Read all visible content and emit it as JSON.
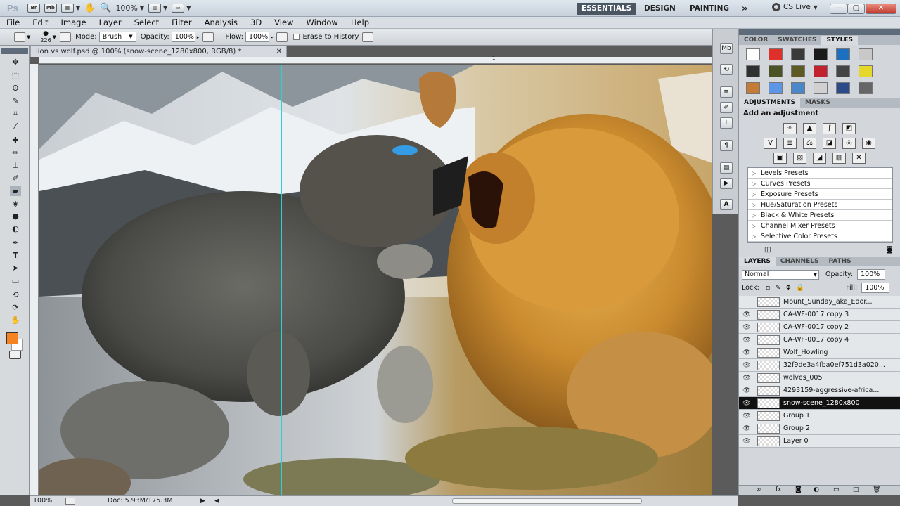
{
  "titlebar": {
    "logo": "Ps",
    "br": "Br",
    "mb": "Mb",
    "zoom": "100%",
    "workspaces": [
      "ESSENTIALS",
      "DESIGN",
      "PAINTING"
    ],
    "more": "»",
    "cs_live": "CS Live",
    "minimize": "—",
    "maximize": "▢",
    "close": "✕"
  },
  "menubar": {
    "items": [
      "File",
      "Edit",
      "Image",
      "Layer",
      "Select",
      "Filter",
      "Analysis",
      "3D",
      "View",
      "Window",
      "Help"
    ]
  },
  "options": {
    "brush_size": "226",
    "mode_label": "Mode:",
    "mode_value": "Brush",
    "opacity_label": "Opacity:",
    "opacity_value": "100%",
    "flow_label": "Flow:",
    "flow_value": "100%",
    "erase_history": "Erase to History"
  },
  "document": {
    "tab_title": "lion vs wolf.psd @ 100% (snow-scene_1280x800, RGB/8) *",
    "zoom": "100%",
    "doc_info": "Doc: 5.93M/175.3M",
    "ruler_mark": "1"
  },
  "panels": {
    "top_tabs": [
      "COLOR",
      "SWATCHES",
      "STYLES"
    ],
    "style_colors": [
      "#ffffff",
      "#e0302a",
      "#3a3a3a",
      "#1a1a1a",
      "#1d6fc0",
      "#c8c8c8",
      "#303030",
      "#4a5226",
      "#5d5a24",
      "#c2222d",
      "#444",
      "#e6d82a",
      "#c57a35",
      "#5f95e6",
      "#4a86c8",
      "#d0d0d0",
      "#2a4a8a",
      "#666"
    ],
    "adj_tabs": [
      "ADJUSTMENTS",
      "MASKS"
    ],
    "adj_title": "Add an adjustment",
    "presets": [
      "Levels Presets",
      "Curves Presets",
      "Exposure Presets",
      "Hue/Saturation Presets",
      "Black & White Presets",
      "Channel Mixer Presets",
      "Selective Color Presets"
    ],
    "layer_tabs": [
      "LAYERS",
      "CHANNELS",
      "PATHS"
    ],
    "blend_mode": "Normal",
    "opacity_label": "Opacity:",
    "opacity_value": "100%",
    "lock_label": "Lock:",
    "fill_label": "Fill:",
    "fill_value": "100%",
    "layers": [
      {
        "name": "Mount_Sunday_aka_Edor...",
        "visible": false,
        "selected": false
      },
      {
        "name": "CA-WF-0017 copy 3",
        "visible": true,
        "selected": false
      },
      {
        "name": "CA-WF-0017 copy 2",
        "visible": true,
        "selected": false
      },
      {
        "name": "CA-WF-0017 copy 4",
        "visible": true,
        "selected": false
      },
      {
        "name": "Wolf_Howling",
        "visible": true,
        "selected": false
      },
      {
        "name": "32f9de3a4fba0ef751d3a020...",
        "visible": true,
        "selected": false
      },
      {
        "name": "wolves_005",
        "visible": true,
        "selected": false
      },
      {
        "name": "4293159-aggressive-africa...",
        "visible": true,
        "selected": false
      },
      {
        "name": "snow-scene_1280x800",
        "visible": true,
        "selected": true
      },
      {
        "name": "Group 1",
        "visible": true,
        "selected": false
      },
      {
        "name": "Group 2",
        "visible": true,
        "selected": false
      },
      {
        "name": "Layer 0",
        "visible": true,
        "selected": false
      }
    ]
  },
  "colors": {
    "foreground": "#f5831f",
    "background": "#ffffff",
    "guide": "#27d3d5"
  }
}
